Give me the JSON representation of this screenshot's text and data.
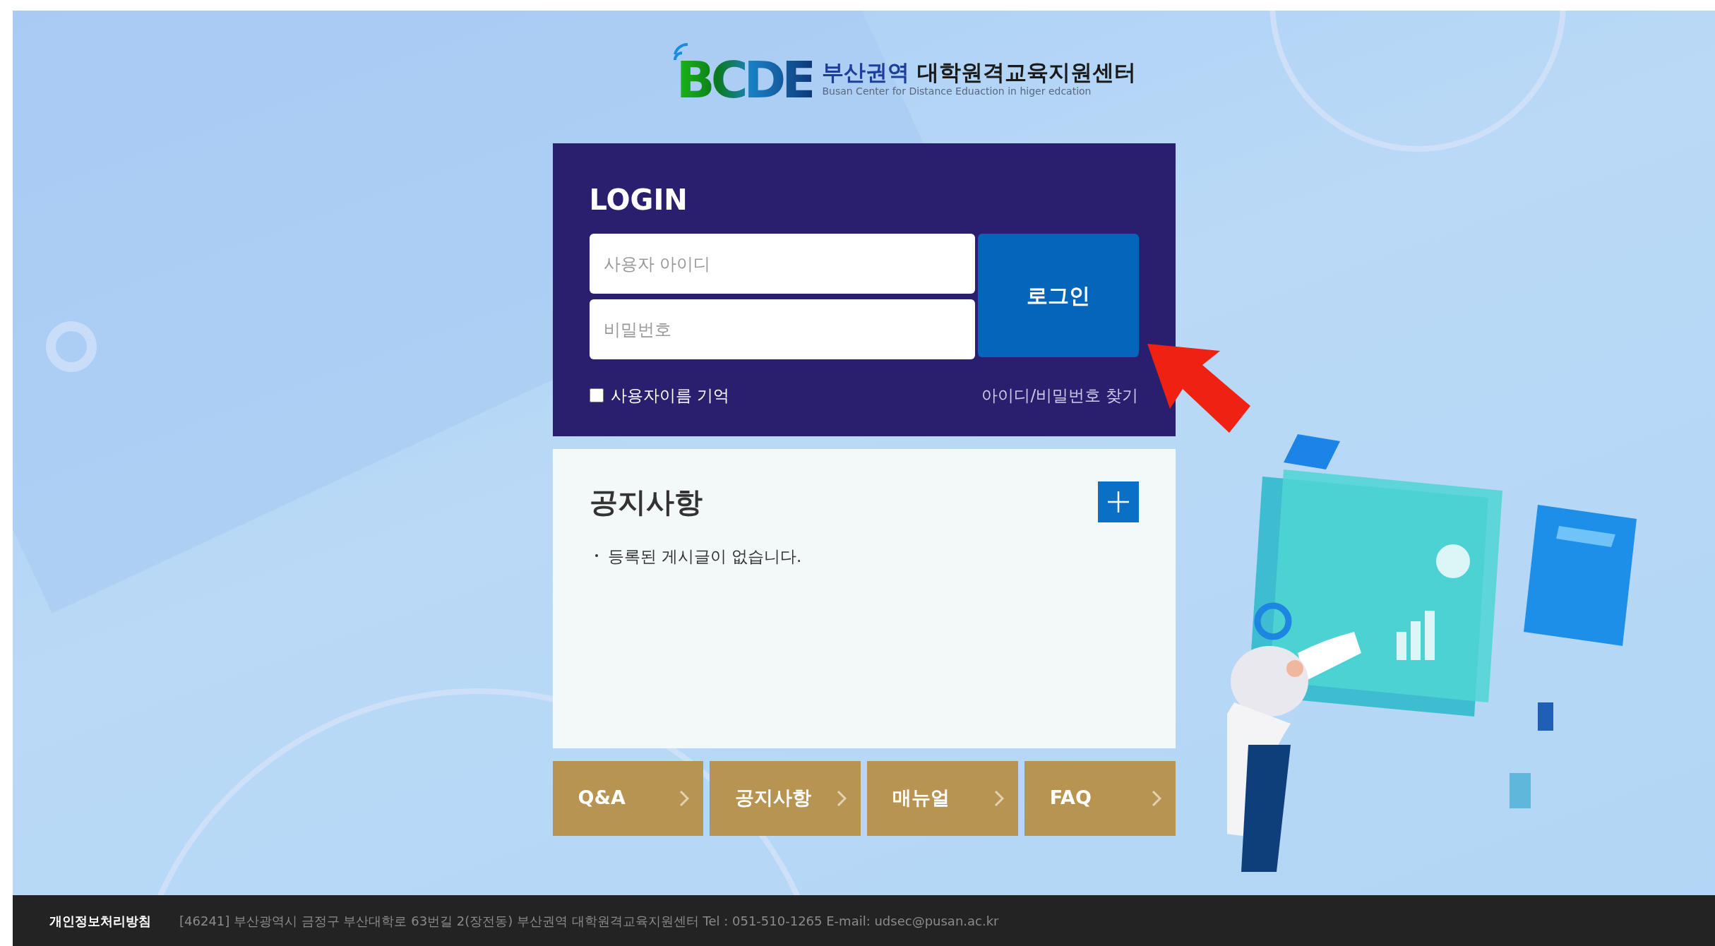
{
  "logo": {
    "mark": "BCDE",
    "region": "부산권역",
    "center": "대학원격교육지원센터",
    "subtitle": "Busan Center for Distance Eduaction in higer edcation"
  },
  "login": {
    "title": "LOGIN",
    "username": {
      "placeholder": "사용자 아이디"
    },
    "password": {
      "placeholder": "비밀번호"
    },
    "button": "로그인",
    "remember": {
      "label": "사용자이름 기억",
      "checked": false
    },
    "find_link": "아이디/비밀번호 찾기"
  },
  "notice": {
    "title": "공지사항",
    "items": [
      "등록된 게시글이 없습니다."
    ]
  },
  "quick_links": [
    {
      "label": "Q&A"
    },
    {
      "label": "공지사항"
    },
    {
      "label": "매뉴얼"
    },
    {
      "label": "FAQ"
    }
  ],
  "footer": {
    "privacy": "개인정보처리방침",
    "address": "[46241] 부산광역시 금정구 부산대학로 63번길 2(장전동) 부산권역 대학원격교육지원센터 Tel : 051-510-1265 E-mail: udsec@pusan.ac.kr"
  }
}
